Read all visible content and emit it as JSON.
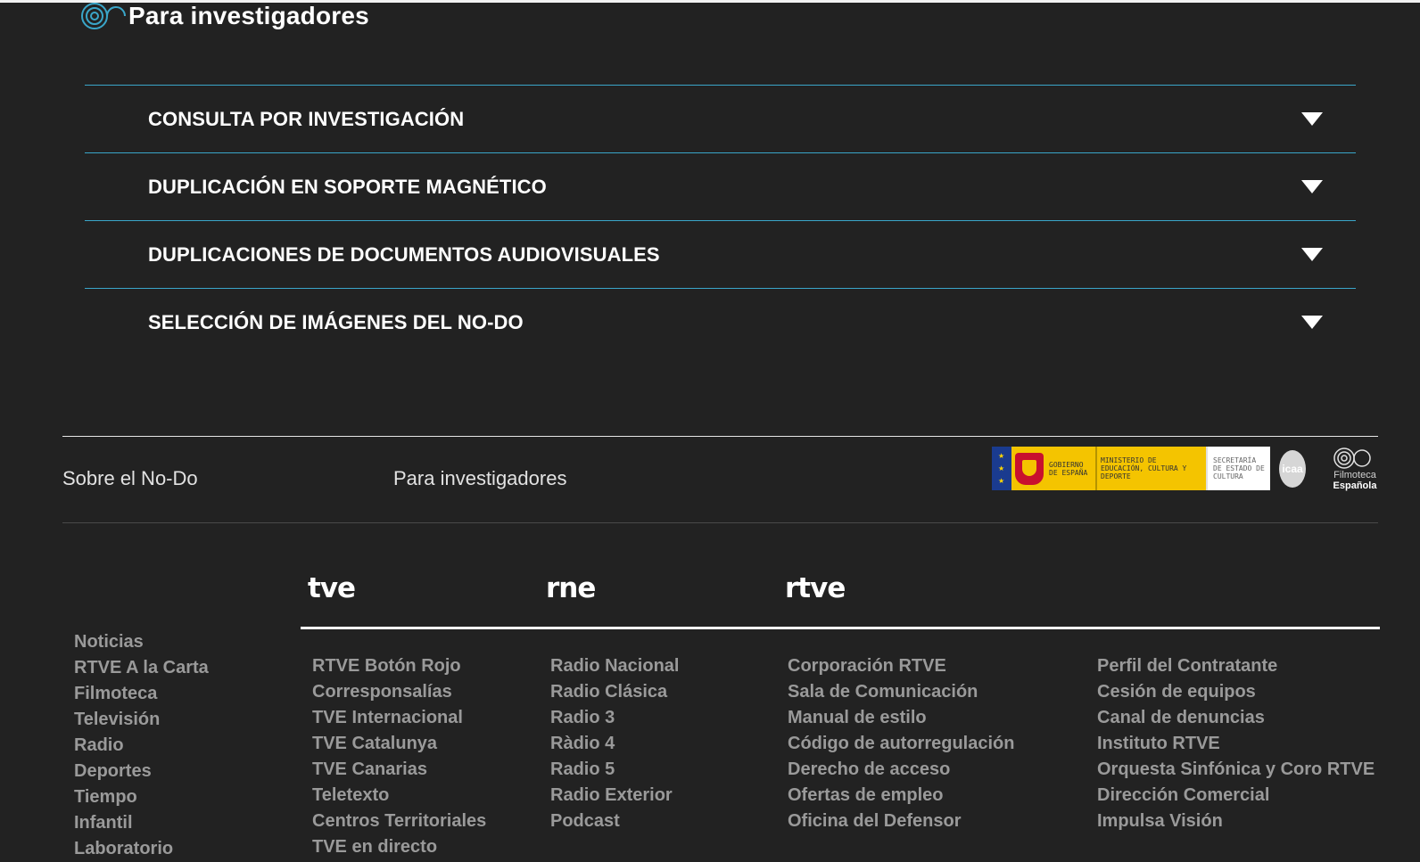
{
  "section": {
    "title": "Para investigadores",
    "logo_icon": "filmoteca-swirl-icon"
  },
  "accordion": [
    {
      "label": "CONSULTA POR INVESTIGACIÓN",
      "icon": "caret-down-icon"
    },
    {
      "label": "DUPLICACIÓN EN SOPORTE MAGNÉTICO",
      "icon": "caret-down-icon"
    },
    {
      "label": "DUPLICACIONES DE DOCUMENTOS AUDIOVISUALES",
      "icon": "caret-down-icon"
    },
    {
      "label": "SELECCIÓN DE IMÁGENES DEL NO-DO",
      "icon": "caret-down-icon"
    }
  ],
  "footer": {
    "links": {
      "sobre": "Sobre el No-Do",
      "investigadores": "Para investigadores"
    },
    "logos": {
      "gobierno": "GOBIERNO DE ESPAÑA",
      "ministerio": "MINISTERIO DE EDUCACIÓN, CULTURA Y DEPORTE",
      "secretaria": "SECRETARÍA DE ESTADO DE CULTURA",
      "icaa": "icaa",
      "filmoteca_l1": "Filmoteca",
      "filmoteca_l2": "Española"
    },
    "brands": {
      "tve": "tve",
      "rne": "rne",
      "rtve": "rtve"
    },
    "columns": {
      "general": [
        "Noticias",
        "RTVE A la Carta",
        "Filmoteca",
        "Televisión",
        "Radio",
        "Deportes",
        "Tiempo",
        "Infantil",
        "Laboratorio"
      ],
      "tve": [
        "RTVE Botón Rojo",
        "Corresponsalías",
        "TVE Internacional",
        "TVE Catalunya",
        "TVE Canarias",
        "Teletexto",
        "Centros Territoriales",
        "TVE en directo"
      ],
      "rne": [
        "Radio Nacional",
        "Radio Clásica",
        "Radio 3",
        "Ràdio 4",
        "Radio 5",
        "Radio Exterior",
        "Podcast"
      ],
      "rtve": [
        "Corporación RTVE",
        "Sala de Comunicación",
        "Manual de estilo",
        "Código de autorregulación",
        "Derecho de acceso",
        "Ofertas de empleo",
        "Oficina del Defensor"
      ],
      "otros": [
        "Perfil del Contratante",
        "Cesión de equipos",
        "Canal de denuncias",
        "Instituto RTVE",
        "Orquesta Sinfónica y Coro RTVE",
        "Dirección Comercial",
        "Impulsa Visión"
      ]
    }
  },
  "colors": {
    "background": "#222222",
    "divider_accent": "#3aa6c9",
    "link_gray": "#9a9a9a"
  }
}
